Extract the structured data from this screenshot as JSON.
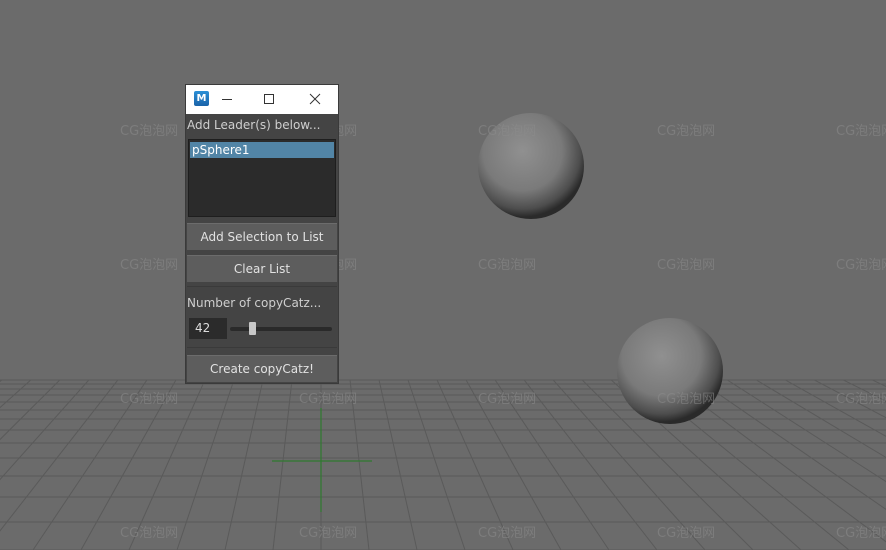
{
  "window": {
    "icon_letter": "M",
    "minimize_icon": "minimize-icon",
    "maximize_icon": "maximize-icon",
    "close_icon": "close-icon"
  },
  "leaders": {
    "label": "Add Leader(s) below...",
    "items": [
      "pSphere1"
    ],
    "add_button": "Add Selection to List",
    "clear_button": "Clear List"
  },
  "copycatz": {
    "label": "Number of copyCatz...",
    "value": "42",
    "slider_fraction": 0.2,
    "create_button": "Create copyCatz!"
  },
  "watermark": {
    "text": "CG泡泡网"
  },
  "colors": {
    "viewport_bg": "#6b6b6b",
    "grid": "#5a5a5a",
    "selection": "#5285a6"
  }
}
